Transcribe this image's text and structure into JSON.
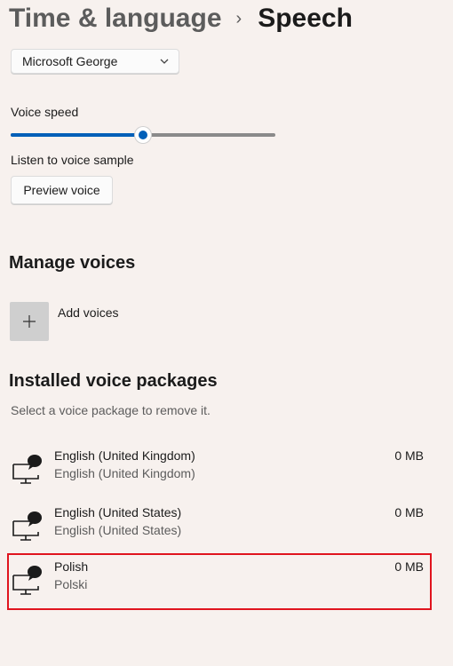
{
  "header": {
    "parent": "Time & language",
    "separator": "›",
    "current": "Speech"
  },
  "voice": {
    "selected_voice": "Microsoft George",
    "speed_label": "Voice speed",
    "speed_value": 0.5,
    "sample_label": "Listen to voice sample",
    "preview_button": "Preview voice"
  },
  "manage": {
    "title": "Manage voices",
    "add_label": "Add voices"
  },
  "installed": {
    "title": "Installed voice packages",
    "hint": "Select a voice package to remove it.",
    "packages": [
      {
        "name": "English (United Kingdom)",
        "native": "English (United Kingdom)",
        "size": "0 MB"
      },
      {
        "name": "English (United States)",
        "native": "English (United States)",
        "size": "0 MB"
      },
      {
        "name": "Polish",
        "native": "Polski",
        "size": "0 MB",
        "selected": true
      }
    ]
  },
  "colors": {
    "accent": "#005fb8",
    "selection_border": "#e0141e",
    "background": "#f7f1ee"
  }
}
